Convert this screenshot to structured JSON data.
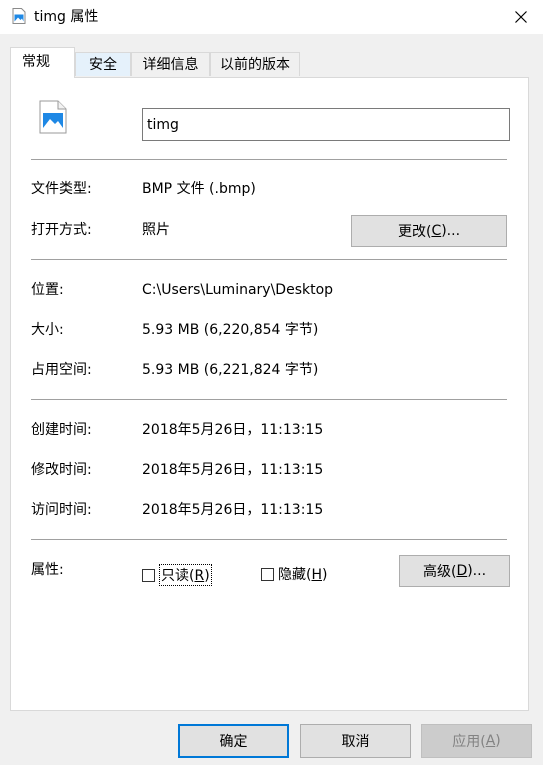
{
  "window": {
    "title": "timg 属性"
  },
  "tabs": [
    {
      "label": "常规"
    },
    {
      "label": "安全"
    },
    {
      "label": "详细信息"
    },
    {
      "label": "以前的版本"
    }
  ],
  "general": {
    "file_name": "timg",
    "file_type_label": "文件类型:",
    "file_type_value": "BMP 文件 (.bmp)",
    "opens_with_label": "打开方式:",
    "opens_with_value": "照片",
    "change_button": {
      "text": "更改(",
      "key": "C",
      "suffix": ")..."
    },
    "location_label": "位置:",
    "location_value": "C:\\Users\\Luminary\\Desktop",
    "size_label": "大小:",
    "size_value": "5.93 MB (6,220,854 字节)",
    "size_on_disk_label": "占用空间:",
    "size_on_disk_value": "5.93 MB (6,221,824 字节)",
    "created_label": "创建时间:",
    "created_value": "2018年5月26日，11:13:15",
    "modified_label": "修改时间:",
    "modified_value": "2018年5月26日，11:13:15",
    "accessed_label": "访问时间:",
    "accessed_value": "2018年5月26日，11:13:15",
    "attributes_label": "属性:",
    "readonly": {
      "text": "只读(",
      "key": "R",
      "suffix": ")",
      "checked": false
    },
    "hidden": {
      "text": "隐藏(",
      "key": "H",
      "suffix": ")",
      "checked": false
    },
    "advanced_button": {
      "text": "高级(",
      "key": "D",
      "suffix": ")..."
    }
  },
  "footer": {
    "ok_label": "确定",
    "cancel_label": "取消",
    "apply_button": {
      "text": "应用(",
      "key": "A",
      "suffix": ")"
    }
  },
  "colors": {
    "accent": "#0078d7",
    "icon_blue": "#1e88e5"
  },
  "icons": {
    "title": "image-file-icon",
    "close": "close-icon",
    "file": "bmp-file-icon"
  }
}
